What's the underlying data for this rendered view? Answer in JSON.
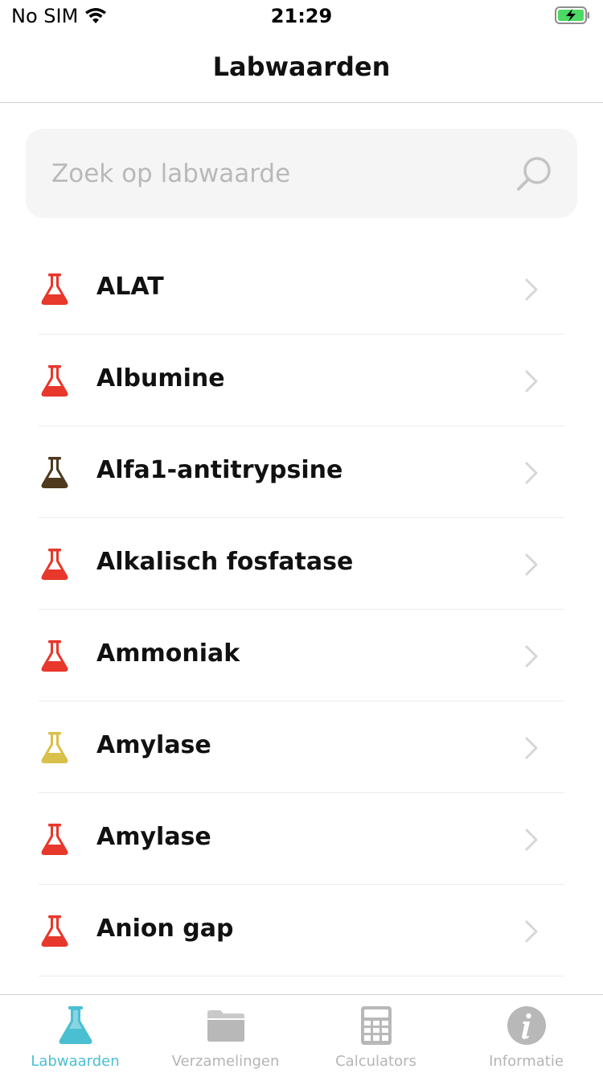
{
  "status_bar": {
    "carrier": "No SIM",
    "time": "21:29",
    "wifi_icon": "wifi-icon",
    "battery_icon": "battery-charging-icon"
  },
  "header": {
    "title": "Labwaarden"
  },
  "search": {
    "placeholder": "Zoek op labwaarde",
    "value": "",
    "icon": "search-icon"
  },
  "items": [
    {
      "label": "ALAT",
      "flask_color": "#e8372b"
    },
    {
      "label": "Albumine",
      "flask_color": "#e8372b"
    },
    {
      "label": "Alfa1-antitrypsine",
      "flask_color": "#4f3a1e"
    },
    {
      "label": "Alkalisch fosfatase",
      "flask_color": "#e8372b"
    },
    {
      "label": "Ammoniak",
      "flask_color": "#e8372b"
    },
    {
      "label": "Amylase",
      "flask_color": "#d9c04a"
    },
    {
      "label": "Amylase",
      "flask_color": "#e8372b"
    },
    {
      "label": "Anion gap",
      "flask_color": "#e8372b"
    }
  ],
  "tabs": [
    {
      "label": "Labwaarden",
      "icon": "flask-icon",
      "active": true
    },
    {
      "label": "Verzamelingen",
      "icon": "folder-icon",
      "active": false
    },
    {
      "label": "Calculators",
      "icon": "calculator-icon",
      "active": false
    },
    {
      "label": "Informatie",
      "icon": "info-icon",
      "active": false
    }
  ],
  "colors": {
    "accent": "#4bbfd2",
    "inactive": "#b5b5b5",
    "red_flask": "#e8372b",
    "brown_flask": "#4f3a1e",
    "yellow_flask": "#d9c04a",
    "battery_green": "#4cd964"
  }
}
